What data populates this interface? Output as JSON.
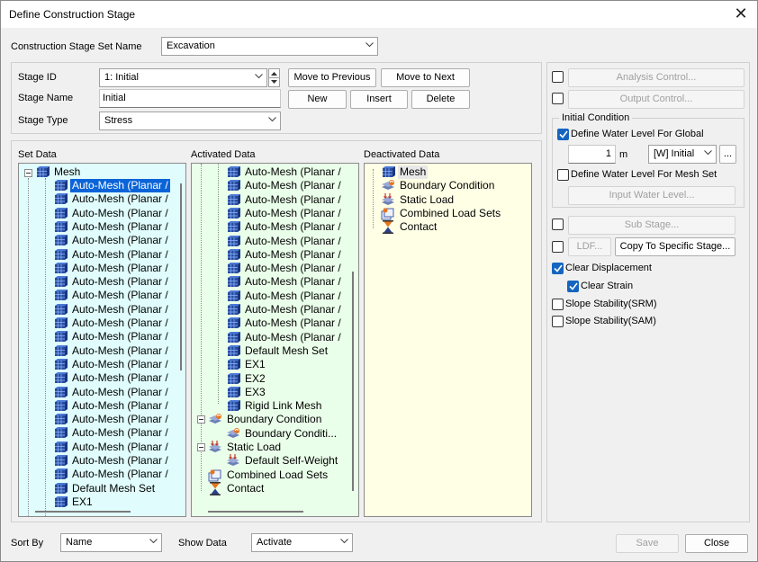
{
  "window": {
    "title": "Define Construction Stage"
  },
  "stage_set": {
    "label": "Construction Stage Set Name",
    "value": "Excavation"
  },
  "stage": {
    "id_label": "Stage ID",
    "id_value": "1: Initial",
    "name_label": "Stage Name",
    "name_value": "Initial",
    "type_label": "Stage Type",
    "type_value": "Stress",
    "buttons": {
      "move_prev": "Move to Previous",
      "move_next": "Move to Next",
      "new": "New",
      "insert": "Insert",
      "delete": "Delete"
    }
  },
  "set_data": {
    "label": "Set Data",
    "root": "Mesh",
    "items": [
      "Auto-Mesh (Planar /",
      "Auto-Mesh (Planar /",
      "Auto-Mesh (Planar /",
      "Auto-Mesh (Planar /",
      "Auto-Mesh (Planar /",
      "Auto-Mesh (Planar /",
      "Auto-Mesh (Planar /",
      "Auto-Mesh (Planar /",
      "Auto-Mesh (Planar /",
      "Auto-Mesh (Planar /",
      "Auto-Mesh (Planar /",
      "Auto-Mesh (Planar /",
      "Auto-Mesh (Planar /",
      "Auto-Mesh (Planar /",
      "Auto-Mesh (Planar /",
      "Auto-Mesh (Planar /",
      "Auto-Mesh (Planar /",
      "Auto-Mesh (Planar /",
      "Auto-Mesh (Planar /",
      "Auto-Mesh (Planar /",
      "Auto-Mesh (Planar /",
      "Auto-Mesh (Planar /",
      "Default Mesh Set",
      "EX1"
    ]
  },
  "activated_data": {
    "label": "Activated Data",
    "mesh_items": [
      "Auto-Mesh (Planar /",
      "Auto-Mesh (Planar /",
      "Auto-Mesh (Planar /",
      "Auto-Mesh (Planar /",
      "Auto-Mesh (Planar /",
      "Auto-Mesh (Planar /",
      "Auto-Mesh (Planar /",
      "Auto-Mesh (Planar /",
      "Auto-Mesh (Planar /",
      "Auto-Mesh (Planar /",
      "Auto-Mesh (Planar /",
      "Auto-Mesh (Planar /",
      "Auto-Mesh (Planar /",
      "Default Mesh Set",
      "EX1",
      "EX2",
      "EX3",
      "Rigid Link Mesh"
    ],
    "boundary": "Boundary Condition",
    "boundary_child": "Boundary Conditi...",
    "static": "Static Load",
    "static_child": "Default Self-Weight",
    "combined": "Combined Load Sets",
    "contact": "Contact"
  },
  "deactivated_data": {
    "label": "Deactivated Data",
    "items": [
      "Mesh",
      "Boundary Condition",
      "Static Load",
      "Combined Load Sets",
      "Contact"
    ]
  },
  "right": {
    "analysis_control": "Analysis Control...",
    "output_control": "Output Control...",
    "initial_condition": "Initial Condition",
    "water_global": "Define Water Level For Global",
    "water_value": "1",
    "water_unit": "m",
    "water_combo": "[W] Initial",
    "ellipsis": "...",
    "water_mesh": "Define Water Level For Mesh Set",
    "input_water": "Input Water Level...",
    "sub_stage": "Sub Stage...",
    "ldf": "LDF...",
    "copy_specific": "Copy To Specific Stage...",
    "clear_displacement": "Clear Displacement",
    "clear_strain": "Clear Strain",
    "slope_srm": "Slope Stability(SRM)",
    "slope_sam": "Slope Stability(SAM)"
  },
  "bottom": {
    "sort_label": "Sort By",
    "sort_value": "Name",
    "show_label": "Show Data",
    "show_value": "Activate",
    "save": "Save",
    "close": "Close"
  }
}
